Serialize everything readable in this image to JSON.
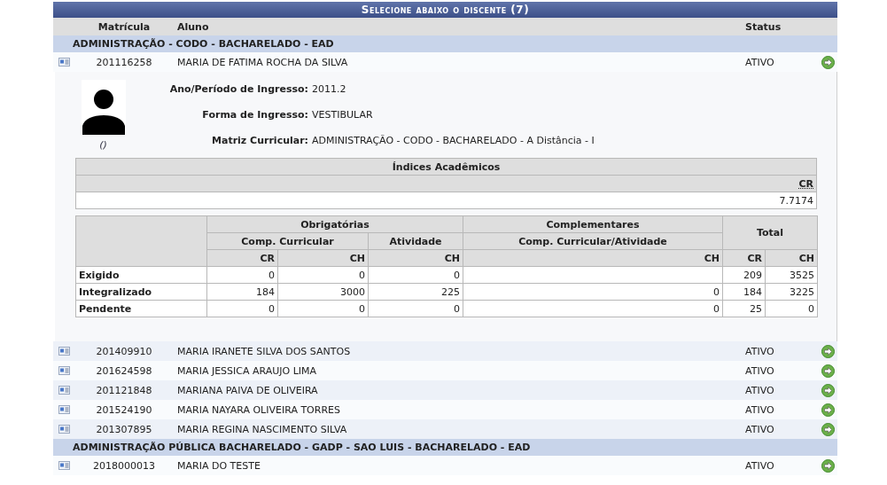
{
  "panel": {
    "title": "Selecione abaixo o discente (7)",
    "columns": [
      "Matrícula",
      "Aluno",
      "Status"
    ],
    "groups": [
      {
        "name": "ADMINISTRAÇÃO - CODO - BACHARELADO - EAD",
        "students": [
          {
            "matricula": "201116258",
            "name": "MARIA DE FATIMA ROCHA DA SILVA",
            "status": "ATIVO",
            "details": {
              "photo_caption": "()",
              "fields": [
                {
                  "label": "Ano/Período de Ingresso:",
                  "value": "2011.2"
                },
                {
                  "label": "Forma de Ingresso:",
                  "value": "VESTIBULAR"
                },
                {
                  "label": "Matriz Curricular:",
                  "value": "ADMINISTRAÇÃO - CODO - BACHARELADO - A Distância - I"
                }
              ],
              "indices": {
                "title": "Índices Acadêmicos",
                "column": "CR",
                "value": "7.7174"
              },
              "workload": {
                "header_groups": [
                  {
                    "title": "Obrigatórias",
                    "kind": "obrigatorias",
                    "subgroups": [
                      {
                        "title": "Comp. Curricular",
                        "columns": [
                          "CR",
                          "CH"
                        ]
                      },
                      {
                        "title": "Atividade",
                        "columns": [
                          "CH"
                        ]
                      }
                    ]
                  },
                  {
                    "title": "Complementares",
                    "kind": "complementares",
                    "subgroups": [
                      {
                        "title": "Comp. Curricular/Atividade",
                        "columns": [
                          "CH"
                        ]
                      }
                    ]
                  },
                  {
                    "title": "Total",
                    "kind": "total",
                    "columns": [
                      "CR",
                      "CH"
                    ]
                  }
                ],
                "rows": [
                  {
                    "label": "Exigido",
                    "obrigatorias": [
                      "0",
                      "0",
                      "0"
                    ],
                    "total": [
                      "209",
                      "3525"
                    ]
                  },
                  {
                    "label": "Integralizado",
                    "obrigatorias": [
                      "184",
                      "3000",
                      "225"
                    ],
                    "complementares": [
                      "0"
                    ],
                    "total": [
                      "184",
                      "3225"
                    ]
                  },
                  {
                    "label": "Pendente",
                    "obrigatorias": [
                      "0",
                      "0",
                      "0"
                    ],
                    "complementares": [
                      "0"
                    ],
                    "total": [
                      "25",
                      "0"
                    ]
                  }
                ]
              }
            }
          },
          {
            "matricula": "201409910",
            "name": "MARIA IRANETE SILVA DOS SANTOS",
            "status": "ATIVO"
          },
          {
            "matricula": "201624598",
            "name": "MARIA JESSICA ARAUJO LIMA",
            "status": "ATIVO"
          },
          {
            "matricula": "201121848",
            "name": "MARIANA PAIVA DE OLIVEIRA",
            "status": "ATIVO"
          },
          {
            "matricula": "201524190",
            "name": "MARIA NAYARA OLIVEIRA TORRES",
            "status": "ATIVO"
          },
          {
            "matricula": "201307895",
            "name": "MARIA REGINA NASCIMENTO SILVA",
            "status": "ATIVO"
          }
        ]
      },
      {
        "name": "ADMINISTRAÇÃO PÚBLICA BACHARELADO - GADP - SAO LUIS - BACHARELADO - EAD",
        "students": [
          {
            "matricula": "2018000013",
            "name": "MARIA DO TESTE",
            "status": "ATIVO"
          }
        ]
      }
    ]
  }
}
